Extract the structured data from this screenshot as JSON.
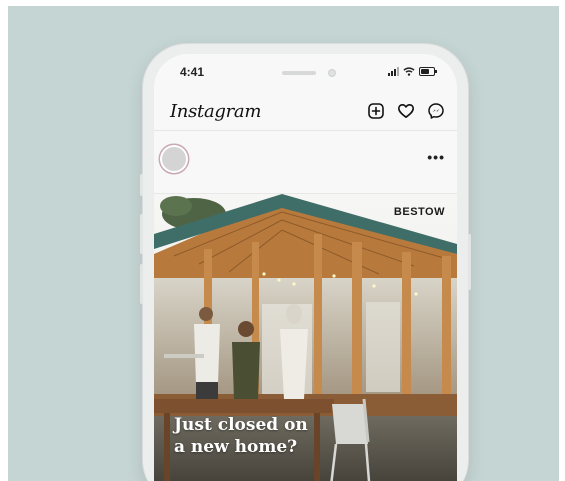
{
  "status_bar": {
    "time": "4:41"
  },
  "app": {
    "logo_text": "Instagram"
  },
  "top_icons": [
    "add-post-icon",
    "heart-icon",
    "messenger-icon"
  ],
  "post": {
    "brand": "BESTOW",
    "caption_line1": "Just closed on",
    "caption_line2": "a new home?",
    "more_label": "•••"
  },
  "colors": {
    "background": "#c5d5d3",
    "phone_body": "#eceeed",
    "screen": "#f8f8f8",
    "roof": "#3f6d68",
    "wood": "#b57437"
  }
}
